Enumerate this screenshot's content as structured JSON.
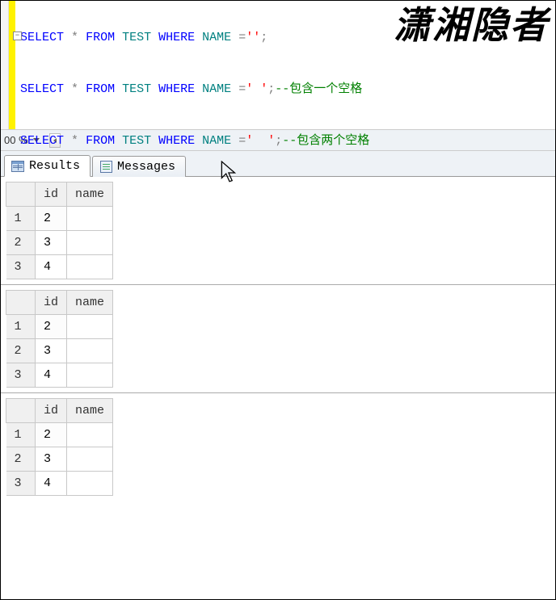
{
  "watermark": "潇湘隐者",
  "zoom": {
    "value": "00 %"
  },
  "code": {
    "k_select": "SELECT",
    "star": "*",
    "k_from": "FROM",
    "tbl": "TEST",
    "k_where": "WHERE",
    "col": "NAME",
    "eq": "=",
    "semi": ";",
    "s1": "''",
    "s2": "' '",
    "s3": "'  '",
    "c2": "--包含一个空格",
    "c3": "--包含两个空格"
  },
  "tabs": {
    "results": "Results",
    "messages": "Messages"
  },
  "grids": [
    {
      "headers": [
        "id",
        "name"
      ],
      "rows": [
        [
          "2",
          ""
        ],
        [
          "3",
          ""
        ],
        [
          "4",
          ""
        ]
      ]
    },
    {
      "headers": [
        "id",
        "name"
      ],
      "rows": [
        [
          "2",
          ""
        ],
        [
          "3",
          ""
        ],
        [
          "4",
          ""
        ]
      ]
    },
    {
      "headers": [
        "id",
        "name"
      ],
      "rows": [
        [
          "2",
          ""
        ],
        [
          "3",
          ""
        ],
        [
          "4",
          ""
        ]
      ]
    }
  ]
}
